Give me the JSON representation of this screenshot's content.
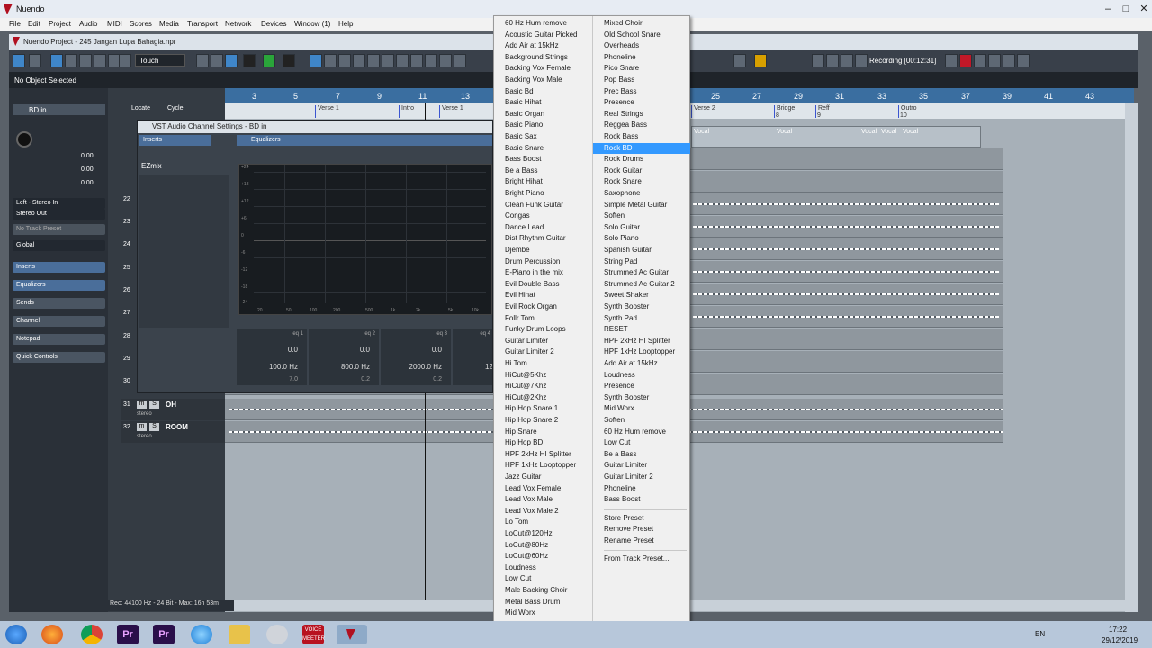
{
  "window": {
    "title": "Nuendo",
    "min": "–",
    "max": "□",
    "close": "✕"
  },
  "menubar": [
    "File",
    "Edit",
    "Project",
    "Audio",
    "MIDI",
    "Scores",
    "Media",
    "Transport",
    "Network",
    "Devices",
    "Window (1)",
    "Help"
  ],
  "project": {
    "title": "Nuendo Project - 245 Jangan Lupa Bahagia.npr"
  },
  "toolbar": {
    "mode": "Touch",
    "record_status": "Recording [00:12:31]"
  },
  "info_line": {
    "text": "No Object Selected"
  },
  "inspector": {
    "track_name": "BD in",
    "values": [
      "0.00",
      "0.00",
      "0.00"
    ],
    "input": "Left - Stereo In",
    "output": "Stereo Out",
    "preset": "No Track Preset",
    "global": "Global",
    "sections": [
      "Inserts",
      "Equalizers",
      "Sends",
      "Channel",
      "Notepad",
      "Quick Controls"
    ]
  },
  "tracklist": {
    "locate": "Locate",
    "cycle": "Cycle",
    "tracks": [
      {
        "num": "22"
      },
      {
        "num": "23"
      },
      {
        "num": "24"
      },
      {
        "num": "25"
      },
      {
        "num": "26"
      },
      {
        "num": "27"
      },
      {
        "num": "28"
      },
      {
        "num": "29"
      },
      {
        "num": "30"
      },
      {
        "num": "31",
        "name": "OH",
        "sub": "stereo"
      },
      {
        "num": "32",
        "name": "ROOM",
        "sub": "stereo"
      }
    ]
  },
  "ruler": {
    "left_marks": [
      "3",
      "5",
      "7",
      "9",
      "11",
      "13"
    ],
    "right_marks": [
      "25",
      "27",
      "29",
      "31",
      "33",
      "35",
      "37",
      "39",
      "41",
      "43"
    ]
  },
  "markers": {
    "items": [
      "Verse 1",
      "Intro",
      "Verse 1",
      "Verse 2",
      "Bridge",
      "Reff",
      "Outro"
    ],
    "ids": [
      "8",
      "9",
      "10"
    ],
    "vocal": "Vocal"
  },
  "vst": {
    "title": "VST Audio Channel Settings - BD in",
    "inserts": "Inserts",
    "equalizers": "Equalizers",
    "plugin": "EZmix",
    "db_labels": [
      "+24",
      "+18",
      "+12",
      "+6",
      "0",
      "-6",
      "-12",
      "-18",
      "-24"
    ],
    "freq_labels": [
      "20",
      "50",
      "100",
      "200",
      "500",
      "1k",
      "2k",
      "5k",
      "10k"
    ],
    "bands": [
      {
        "label": "eq 1",
        "gain": "0.0",
        "freq": "100.0 Hz",
        "q": "7.0"
      },
      {
        "label": "eq 2",
        "gain": "0.0",
        "freq": "800.0 Hz",
        "q": "0.2"
      },
      {
        "label": "eq 3",
        "gain": "0.0",
        "freq": "2000.0 Hz",
        "q": "0.2"
      },
      {
        "label": "eq 4",
        "freq": "12"
      }
    ]
  },
  "preset_menu": {
    "col1": [
      "60 Hz Hum remove",
      "Acoustic Guitar Picked",
      "Add Air at 15kHz",
      "Background Strings",
      "Backing Vox Female",
      "Backing Vox Male",
      "Basic Bd",
      "Basic Hihat",
      "Basic Organ",
      "Basic Piano",
      "Basic Sax",
      "Basic Snare",
      "Bass Boost",
      "Be a Bass",
      "Bright Hihat",
      "Bright Piano",
      "Clean Funk Guitar",
      "Congas",
      "Dance Lead",
      "Dist Rhythm Guitar",
      "Djembe",
      "Drum Percussion",
      "E-Piano in the mix",
      "Evil Double Bass",
      "Evil Hihat",
      "Evil Rock Organ",
      "Follr Tom",
      "Funky Drum Loops",
      "Guitar Limiter",
      "Guitar Limiter 2",
      "Hi Tom",
      "HiCut@5Khz",
      "HiCut@7Khz",
      "HiCut@2Khz",
      "Hip Hop Snare 1",
      "Hip Hop Snare 2",
      "Hip Snare",
      "Hip Hop BD",
      "HPF 2kHz HI Splitter",
      "HPF 1kHz Looptopper",
      "Jazz Guitar",
      "Lead Vox Female",
      "Lead Vox Male",
      "Lead Vox Male 2",
      "Lo Tom",
      "LoCut@120Hz",
      "LoCut@80Hz",
      "LoCut@60Hz",
      "Loudness",
      "Low Cut",
      "Male Backing Choir",
      "Metal Bass Drum",
      "Mid Worx"
    ],
    "col2": [
      "Mixed Choir",
      "Old School Snare",
      "Overheads",
      "Phoneline",
      "Pico Snare",
      "Pop Bass",
      "Prec Bass",
      "Presence",
      "Real Strings",
      "Reggea Bass",
      "Rock Bass",
      "Rock BD",
      "Rock Drums",
      "Rock Guitar",
      "Rock Snare",
      "Saxophone",
      "Simple Metal Guitar",
      "Soften",
      "Solo Guitar",
      "Solo Piano",
      "Spanish Guitar",
      "String Pad",
      "Strummed Ac Guitar",
      "Strummed Ac Guitar 2",
      "Sweet Shaker",
      "Synth Booster",
      "Synth Pad",
      "RESET",
      "HPF 2kHz HI Splitter",
      "HPF 1kHz Looptopper",
      "Add Air at 15kHz",
      "Loudness",
      "Presence",
      "Synth Booster",
      "Mid Worx",
      "Soften",
      "60 Hz Hum remove",
      "Low Cut",
      "Be a Bass",
      "Guitar Limiter",
      "Guitar Limiter 2",
      "Phoneline",
      "Bass Boost"
    ],
    "selected": "Rock BD",
    "actions": [
      "Store Preset",
      "Remove Preset",
      "Rename Preset"
    ],
    "from_track": "From Track Preset..."
  },
  "status": {
    "text": "Rec: 44100 Hz - 24 Bit - Max: 16h 53m"
  },
  "taskbar": {
    "lang": "EN",
    "time": "17:22",
    "date": "29/12/2019",
    "voicemeeter": "VOICE MEETER"
  }
}
